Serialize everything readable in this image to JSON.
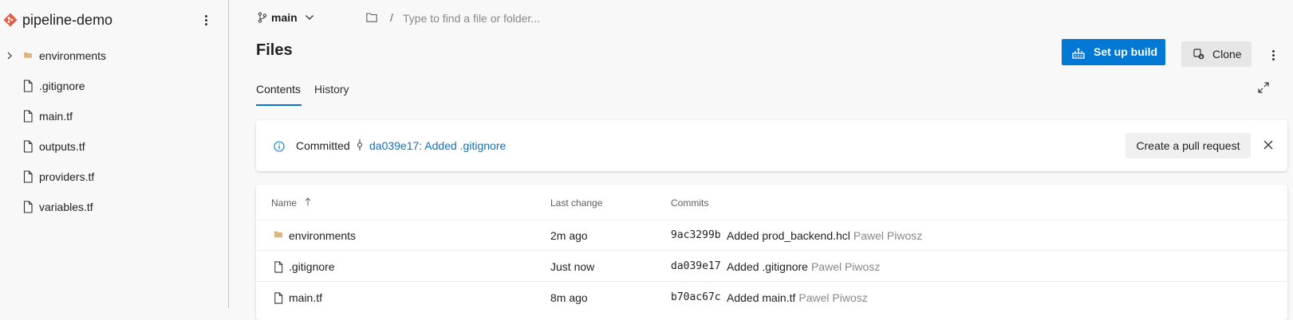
{
  "sidebar": {
    "repo_name": "pipeline-demo",
    "items": [
      {
        "label": "environments",
        "type": "folder"
      },
      {
        "label": ".gitignore",
        "type": "file"
      },
      {
        "label": "main.tf",
        "type": "file"
      },
      {
        "label": "outputs.tf",
        "type": "file"
      },
      {
        "label": "providers.tf",
        "type": "file"
      },
      {
        "label": "variables.tf",
        "type": "file"
      }
    ]
  },
  "topbar": {
    "branch": "main",
    "path_separator": "/",
    "path_placeholder": "Type to find a file or folder..."
  },
  "page": {
    "title": "Files",
    "setup_build_label": "Set up build",
    "clone_label": "Clone",
    "tabs": [
      {
        "label": "Contents",
        "active": true
      },
      {
        "label": "History",
        "active": false
      }
    ]
  },
  "banner": {
    "status": "Committed",
    "commit_link": "da039e17: Added .gitignore",
    "pr_button": "Create a pull request"
  },
  "table": {
    "headers": {
      "name": "Name",
      "last_change": "Last change",
      "commits": "Commits"
    },
    "rows": [
      {
        "name": "environments",
        "type": "folder",
        "last_change": "2m ago",
        "hash": "9ac3299b",
        "message": "Added prod_backend.hcl",
        "author": "Pawel Piwosz"
      },
      {
        "name": ".gitignore",
        "type": "file",
        "last_change": "Just now",
        "hash": "da039e17",
        "message": "Added .gitignore",
        "author": "Pawel Piwosz"
      },
      {
        "name": "main.tf",
        "type": "file",
        "last_change": "8m ago",
        "hash": "b70ac67c",
        "message": "Added main.tf",
        "author": "Pawel Piwosz"
      }
    ]
  },
  "colors": {
    "accent": "#0078d4",
    "link": "#106ebe",
    "folder": "#dcb67a",
    "repo_logo": "#e05d44"
  },
  "icons": [
    "repo-logo-icon",
    "more-options-icon",
    "chevron-right-icon",
    "folder-icon",
    "file-icon",
    "branch-icon",
    "chevron-down-icon",
    "build-icon",
    "clone-icon",
    "expand-icon",
    "info-icon",
    "commit-icon",
    "close-icon",
    "sort-ascending-icon"
  ]
}
